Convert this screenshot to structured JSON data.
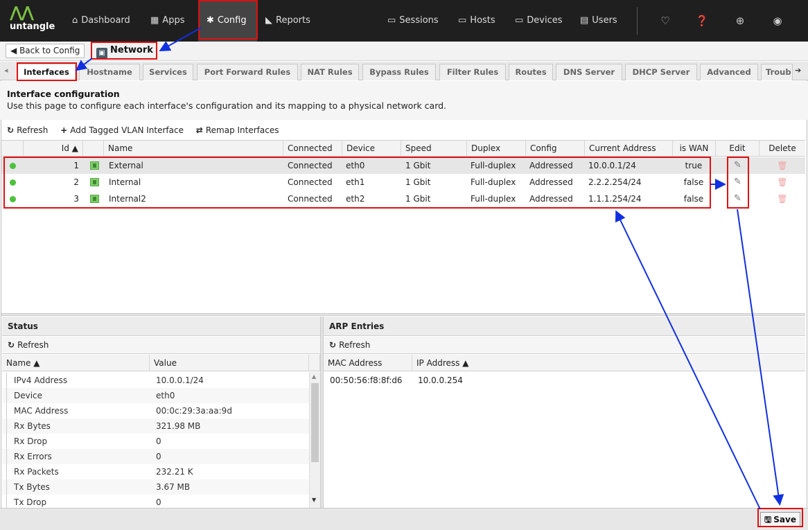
{
  "topbar": {
    "logo_text": "untangle",
    "nav": [
      {
        "label": "Dashboard",
        "icon": "home-icon"
      },
      {
        "label": "Apps",
        "icon": "apps-grid-icon"
      },
      {
        "label": "Config",
        "icon": "cogs-icon"
      },
      {
        "label": "Reports",
        "icon": "area-chart-icon"
      }
    ],
    "right_nav": [
      {
        "label": "Sessions",
        "icon": "sessions-icon"
      },
      {
        "label": "Hosts",
        "icon": "hosts-icon"
      },
      {
        "label": "Devices",
        "icon": "devices-icon"
      },
      {
        "label": "Users",
        "icon": "users-icon"
      }
    ],
    "utility_icons": [
      "lightbulb-icon",
      "help-icon",
      "support-icon",
      "account-icon"
    ]
  },
  "breadcrumb": {
    "back_label": "Back to Config",
    "title": "Network"
  },
  "tabs": [
    "Interfaces",
    "Hostname",
    "Services",
    "Port Forward Rules",
    "NAT Rules",
    "Bypass Rules",
    "Filter Rules",
    "Routes",
    "DNS Server",
    "DHCP Server",
    "Advanced",
    "Troub"
  ],
  "config": {
    "title": "Interface configuration",
    "description": "Use this page to configure each interface's configuration and its mapping to a physical network card."
  },
  "toolbar": {
    "refresh": "Refresh",
    "add_vlan": "Add Tagged VLAN Interface",
    "remap": "Remap Interfaces"
  },
  "grid": {
    "columns": [
      "Id ▲",
      "Name",
      "Connected",
      "Device",
      "Speed",
      "Duplex",
      "Config",
      "Current Address",
      "is WAN",
      "Edit",
      "Delete"
    ],
    "rows": [
      {
        "id": "1",
        "name": "External",
        "connected": "Connected",
        "device": "eth0",
        "speed": "1 Gbit",
        "duplex": "Full-duplex",
        "config": "Addressed",
        "address": "10.0.0.1/24",
        "wan": "true"
      },
      {
        "id": "2",
        "name": "Internal",
        "connected": "Connected",
        "device": "eth1",
        "speed": "1 Gbit",
        "duplex": "Full-duplex",
        "config": "Addressed",
        "address": "2.2.2.254/24",
        "wan": "false"
      },
      {
        "id": "3",
        "name": "Internal2",
        "connected": "Connected",
        "device": "eth2",
        "speed": "1 Gbit",
        "duplex": "Full-duplex",
        "config": "Addressed",
        "address": "1.1.1.254/24",
        "wan": "false"
      }
    ]
  },
  "status": {
    "title": "Status",
    "refresh": "Refresh",
    "col_name": "Name ▲",
    "col_value": "Value",
    "rows": [
      {
        "k": "IPv4 Address",
        "v": "10.0.0.1/24"
      },
      {
        "k": "Device",
        "v": "eth0"
      },
      {
        "k": "MAC Address",
        "v": "00:0c:29:3a:aa:9d"
      },
      {
        "k": "Rx Bytes",
        "v": "321.98 MB"
      },
      {
        "k": "Rx Drop",
        "v": "0"
      },
      {
        "k": "Rx Errors",
        "v": "0"
      },
      {
        "k": "Rx Packets",
        "v": "232.21 K"
      },
      {
        "k": "Tx Bytes",
        "v": "3.67 MB"
      },
      {
        "k": "Tx Drop",
        "v": "0"
      }
    ]
  },
  "arp": {
    "title": "ARP Entries",
    "refresh": "Refresh",
    "col_mac": "MAC Address",
    "col_ip": "IP Address ▲",
    "rows": [
      {
        "mac": "00:50:56:f8:8f:d6",
        "ip": "10.0.0.254"
      }
    ]
  },
  "footer": {
    "save": "Save"
  },
  "colors": {
    "annotation_red": "#e01010",
    "annotation_arrow": "#1030e0",
    "status_green": "#4cc13b",
    "logo_green": "#7cbf42"
  }
}
